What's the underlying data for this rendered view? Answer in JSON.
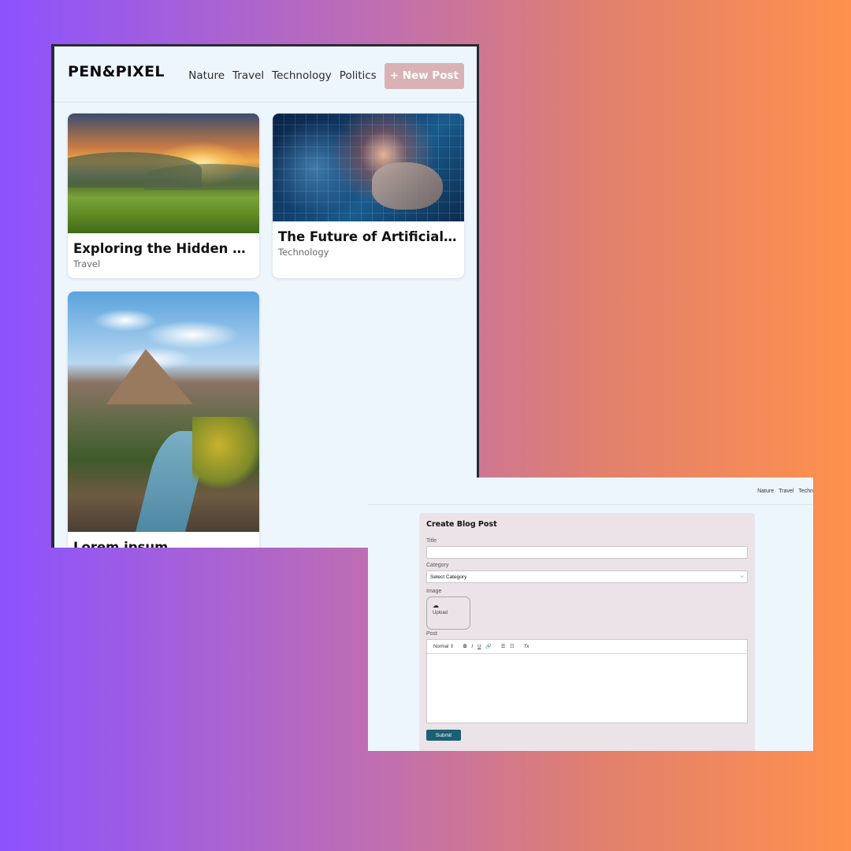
{
  "feed": {
    "logo": "PEN&PIXEL",
    "nav": [
      "Nature",
      "Travel",
      "Technology",
      "Politics"
    ],
    "new_post_label": "+ New Post",
    "cards": [
      {
        "title": "Exploring the Hidden Gem...",
        "category": "Travel",
        "image": "sunset-meadow-photo"
      },
      {
        "title": "The Future of Artificial Inte...",
        "category": "Technology",
        "image": "digital-hand-tech-photo"
      },
      {
        "title": "Lorem ipsum",
        "category": "",
        "image": "canyon-river-photo"
      }
    ]
  },
  "form_screen": {
    "nav": [
      "Nature",
      "Travel",
      "Techn"
    ],
    "heading": "Create Blog Post",
    "title_label": "Title",
    "category_label": "Category",
    "category_selected": "Select Category",
    "image_label": "Image",
    "upload_label": "Upload",
    "post_label": "Post",
    "editor_format": "Normal",
    "toolbar": [
      "B",
      "I",
      "U",
      "🔗",
      "☰",
      "☷",
      "Tx"
    ],
    "submit_label": "Submit"
  },
  "colors": {
    "new_post_button": "#d9b2b5",
    "submit_button": "#1b5f74",
    "page_background": "#eef6fd"
  }
}
